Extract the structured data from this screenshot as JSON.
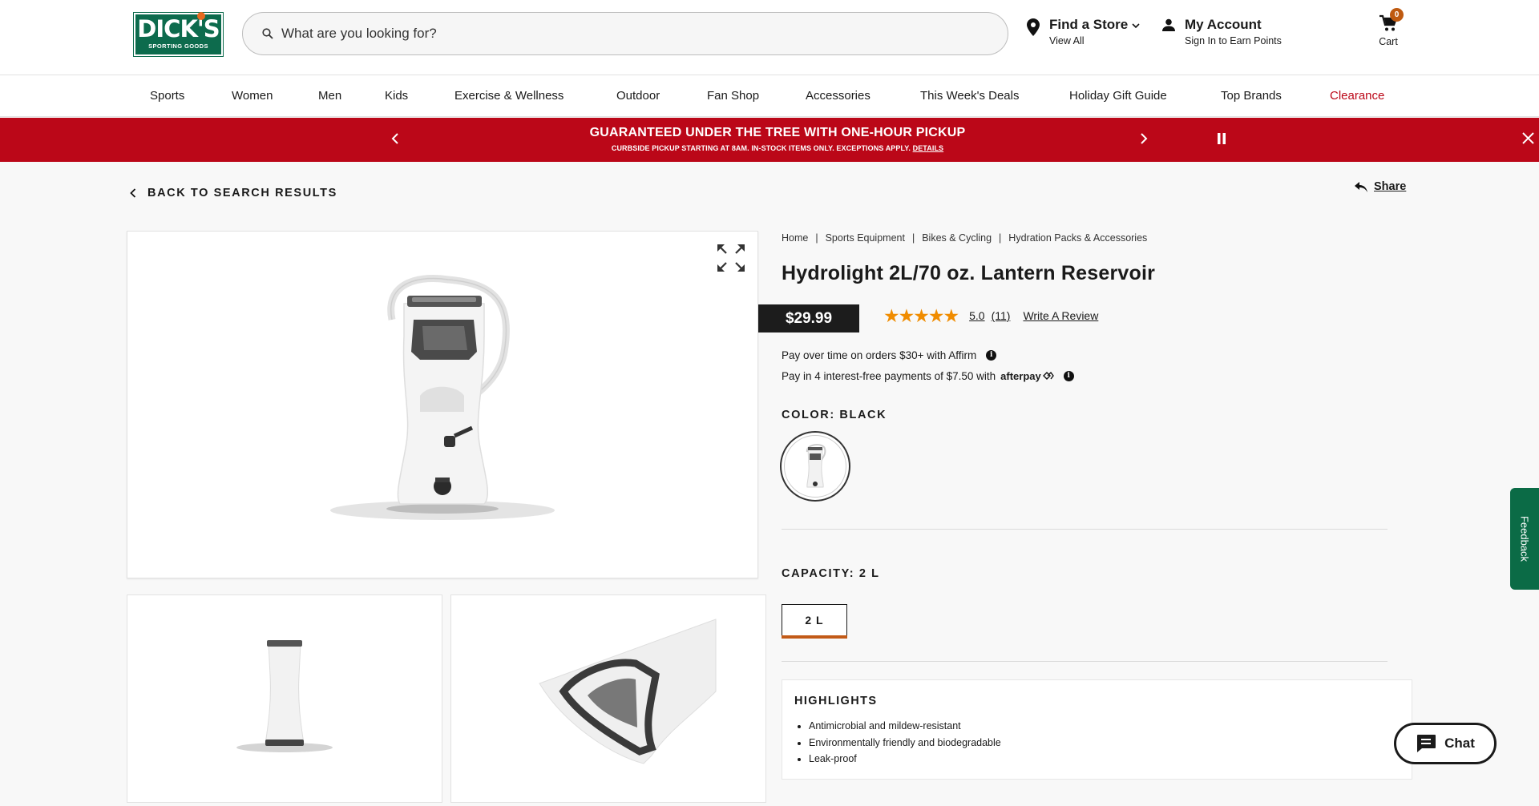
{
  "header": {
    "logo_main": "DICK'S",
    "logo_sub": "SPORTING GOODS",
    "search_placeholder": "What are you looking for?",
    "find_store_title": "Find a Store",
    "find_store_sub": "View All",
    "account_title": "My Account",
    "account_sub": "Sign In to Earn Points",
    "cart_label": "Cart",
    "cart_count": "0"
  },
  "nav": [
    "Sports",
    "Women",
    "Men",
    "Kids",
    "Exercise & Wellness",
    "Outdoor",
    "Fan Shop",
    "Accessories",
    "This Week's Deals",
    "Holiday Gift Guide",
    "Top Brands",
    "Clearance"
  ],
  "promo": {
    "title": "GUARANTEED UNDER THE TREE WITH ONE-HOUR PICKUP",
    "subtitle": "CURBSIDE PICKUP STARTING AT 8AM. IN-STOCK ITEMS ONLY. EXCEPTIONS APPLY.",
    "details_link": "DETAILS"
  },
  "back_label": "BACK TO SEARCH RESULTS",
  "share_label": "Share",
  "breadcrumbs": [
    "Home",
    "Sports Equipment",
    "Bikes & Cycling",
    "Hydration Packs & Accessories"
  ],
  "product": {
    "title": "Hydrolight 2L/70 oz. Lantern Reservoir",
    "price": "$29.99",
    "stars": "★★★★★",
    "rating": "5.0",
    "review_count": "(11)",
    "write_review": "Write A Review",
    "affirm_text": "Pay over time on orders $30+ with Affirm",
    "afterpay_text": "Pay in 4 interest-free payments of $7.50 with",
    "afterpay_brand": "afterpay",
    "color_label": "COLOR: BLACK",
    "capacity_label": "CAPACITY: 2 L",
    "capacity_option": "2 L",
    "highlights_title": "HIGHLIGHTS",
    "highlights": [
      "Antimicrobial and mildew-resistant",
      "Environmentally friendly and biodegradable",
      "Leak-proof"
    ]
  },
  "widgets": {
    "feedback": "Feedback",
    "chat": "Chat"
  },
  "colors": {
    "promo_red": "#bb0718",
    "brand_green": "#0d6b4d",
    "clearance_red": "#bb0718",
    "capacity_underline": "#c25a17",
    "star_orange": "#f08c00"
  }
}
